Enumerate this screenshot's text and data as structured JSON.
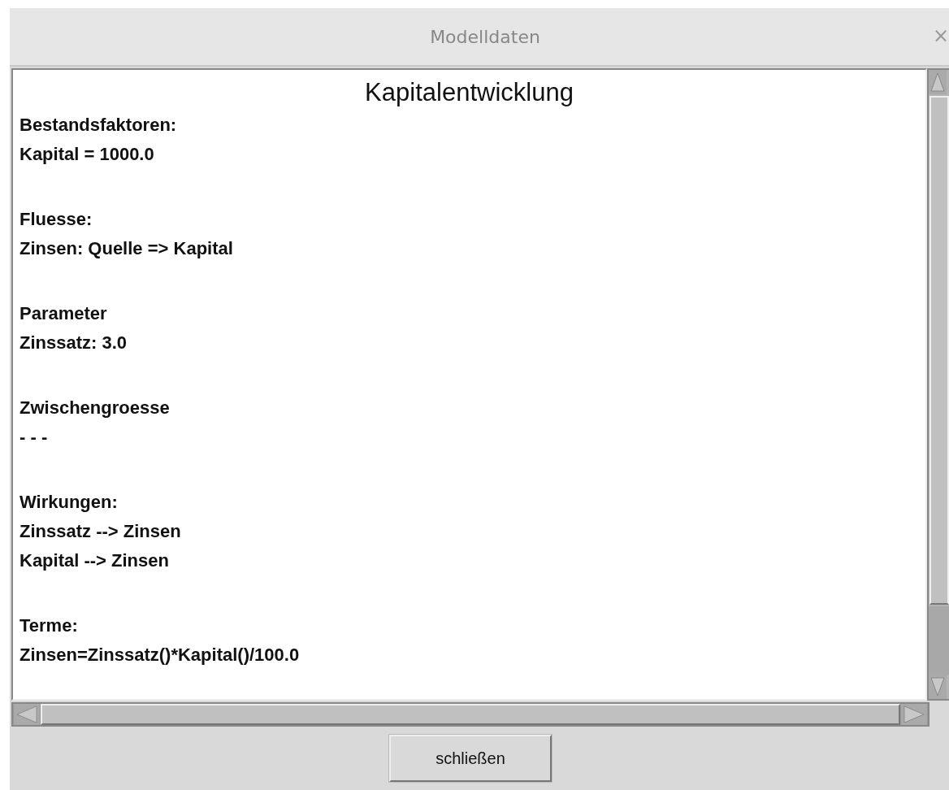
{
  "window": {
    "title": "Modelldaten",
    "close": "×"
  },
  "document": {
    "heading": "Kapitalentwicklung",
    "sections": [
      {
        "title": "Bestandsfaktoren:",
        "lines": [
          "Kapital = 1000.0"
        ]
      },
      {
        "title": "Fluesse:",
        "lines": [
          "Zinsen: Quelle => Kapital"
        ]
      },
      {
        "title": "Parameter",
        "lines": [
          "Zinssatz: 3.0"
        ]
      },
      {
        "title": "Zwischengroesse",
        "lines": [
          "- - -"
        ]
      },
      {
        "title": "Wirkungen:",
        "lines": [
          "Zinssatz --> Zinsen",
          "Kapital --> Zinsen"
        ]
      },
      {
        "title": "Terme:",
        "lines": [
          "Zinsen=Zinssatz()*Kapital()/100.0"
        ]
      }
    ]
  },
  "buttons": [
    "schließen"
  ]
}
